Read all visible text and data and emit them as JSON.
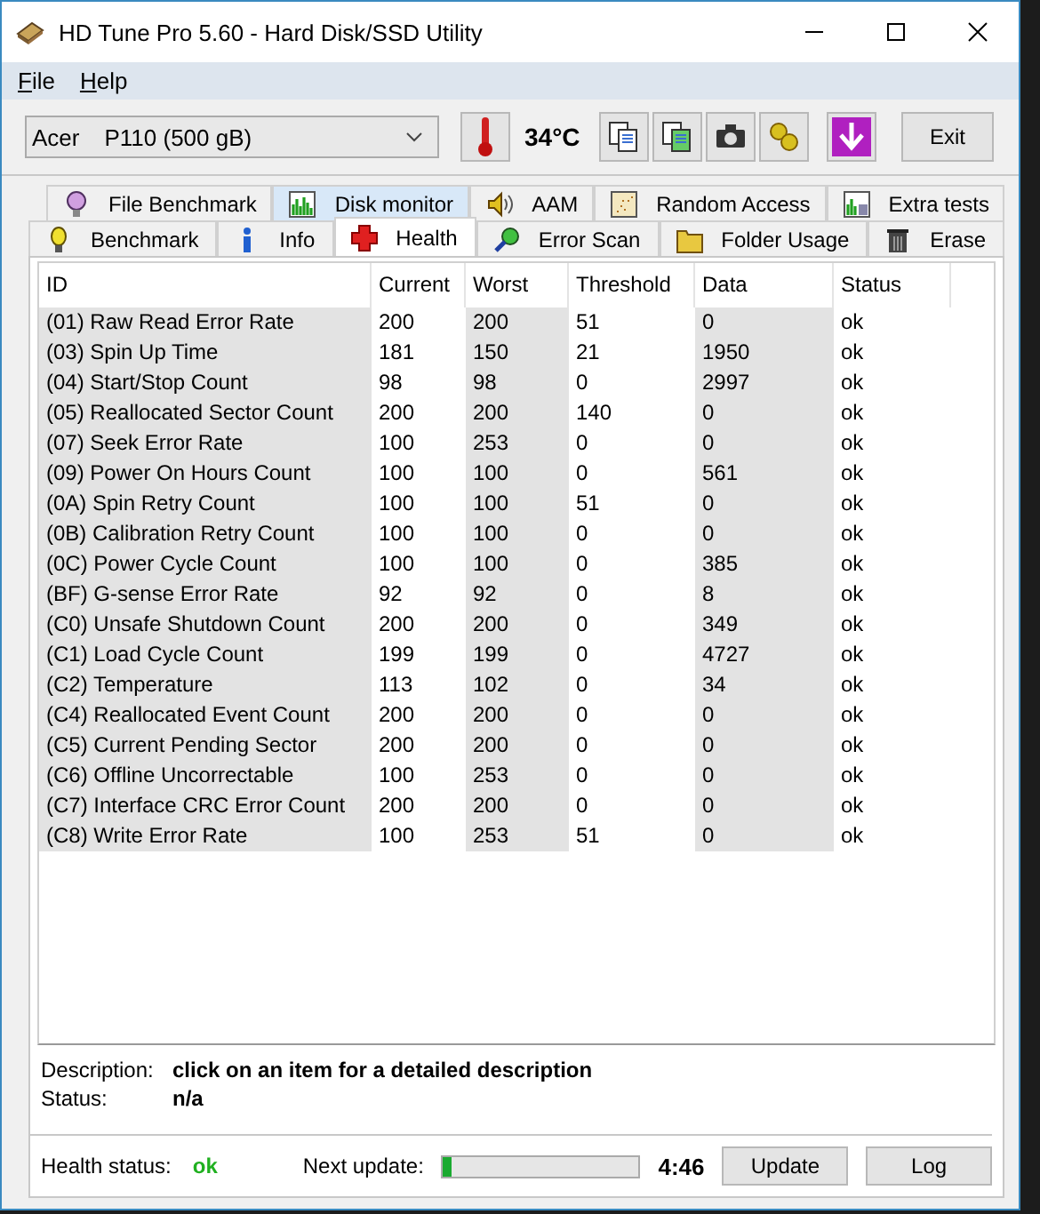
{
  "window": {
    "title": "HD Tune Pro 5.60 - Hard Disk/SSD Utility"
  },
  "menu": [
    {
      "label": "File"
    },
    {
      "label": "Help"
    }
  ],
  "toolbar": {
    "drive_vendor": "Acer",
    "drive_model": "P110 (500 gB)",
    "temperature": "34°C",
    "exit": "Exit"
  },
  "tabs_top": [
    {
      "label": "File Benchmark",
      "selected": false,
      "hovered": false
    },
    {
      "label": "Disk monitor",
      "selected": false,
      "hovered": true
    },
    {
      "label": "AAM",
      "selected": false,
      "hovered": false
    },
    {
      "label": "Random Access",
      "selected": false,
      "hovered": false
    },
    {
      "label": "Extra tests",
      "selected": false,
      "hovered": false
    }
  ],
  "tabs_bottom": [
    {
      "label": "Benchmark",
      "selected": false
    },
    {
      "label": "Info",
      "selected": false
    },
    {
      "label": "Health",
      "selected": true
    },
    {
      "label": "Error Scan",
      "selected": false
    },
    {
      "label": "Folder Usage",
      "selected": false
    },
    {
      "label": "Erase",
      "selected": false
    }
  ],
  "table": {
    "columns": [
      "ID",
      "Current",
      "Worst",
      "Threshold",
      "Data",
      "Status"
    ],
    "rows": [
      [
        "(01) Raw Read Error Rate",
        "200",
        "200",
        "51",
        "0",
        "ok"
      ],
      [
        "(03) Spin Up Time",
        "181",
        "150",
        "21",
        "1950",
        "ok"
      ],
      [
        "(04) Start/Stop Count",
        "98",
        "98",
        "0",
        "2997",
        "ok"
      ],
      [
        "(05) Reallocated Sector Count",
        "200",
        "200",
        "140",
        "0",
        "ok"
      ],
      [
        "(07) Seek Error Rate",
        "100",
        "253",
        "0",
        "0",
        "ok"
      ],
      [
        "(09) Power On Hours Count",
        "100",
        "100",
        "0",
        "561",
        "ok"
      ],
      [
        "(0A) Spin Retry Count",
        "100",
        "100",
        "51",
        "0",
        "ok"
      ],
      [
        "(0B) Calibration Retry Count",
        "100",
        "100",
        "0",
        "0",
        "ok"
      ],
      [
        "(0C) Power Cycle Count",
        "100",
        "100",
        "0",
        "385",
        "ok"
      ],
      [
        "(BF) G-sense Error Rate",
        "92",
        "92",
        "0",
        "8",
        "ok"
      ],
      [
        "(C0) Unsafe Shutdown Count",
        "200",
        "200",
        "0",
        "349",
        "ok"
      ],
      [
        "(C1) Load Cycle Count",
        "199",
        "199",
        "0",
        "4727",
        "ok"
      ],
      [
        "(C2) Temperature",
        "113",
        "102",
        "0",
        "34",
        "ok"
      ],
      [
        "(C4) Reallocated Event Count",
        "200",
        "200",
        "0",
        "0",
        "ok"
      ],
      [
        "(C5) Current Pending Sector",
        "200",
        "200",
        "0",
        "0",
        "ok"
      ],
      [
        "(C6) Offline Uncorrectable",
        "100",
        "253",
        "0",
        "0",
        "ok"
      ],
      [
        "(C7) Interface CRC Error Count",
        "200",
        "200",
        "0",
        "0",
        "ok"
      ],
      [
        "(C8) Write Error Rate",
        "100",
        "253",
        "51",
        "0",
        "ok"
      ]
    ]
  },
  "details": {
    "description_label": "Description:",
    "description": "click on an item for a detailed description",
    "status_label": "Status:",
    "status": "n/a"
  },
  "footer": {
    "health_label": "Health status:",
    "health": "ok",
    "next_label": "Next update:",
    "level": 0.04,
    "countdown": "4:46",
    "update": "Update",
    "log": "Log"
  }
}
